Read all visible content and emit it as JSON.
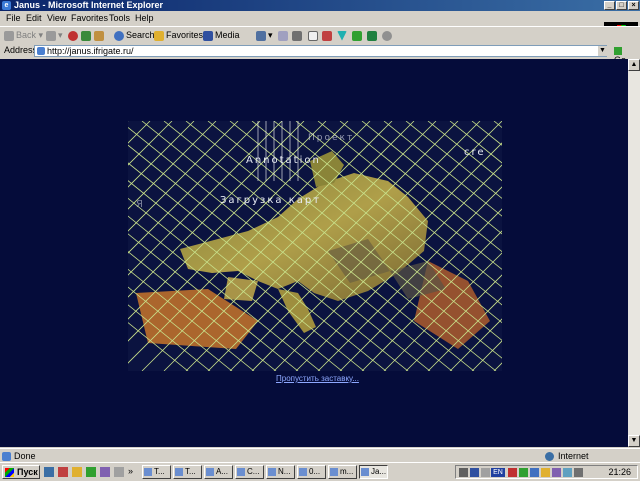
{
  "window": {
    "title": "Janus - Microsoft Internet Explorer"
  },
  "menu": [
    "File",
    "Edit",
    "View",
    "Favorites",
    "Tools",
    "Help"
  ],
  "toolbar": {
    "back": "Back",
    "search": "Search",
    "favorites": "Favorites",
    "media": "Media"
  },
  "address": {
    "label": "Address",
    "url": "http://janus.ifrigate.ru/",
    "go": "Go"
  },
  "page": {
    "overlay_texts": [
      "Annotation",
      "cre",
      "Загрузка карт",
      "Проект",
      "Я"
    ],
    "skip_link": "Пропустить заставку..."
  },
  "status": {
    "left": "Done",
    "zone": "Internet"
  },
  "taskbar": {
    "start": "Пуск",
    "tasks": [
      "T...",
      "T...",
      "A...",
      "C...",
      "N...",
      "0...",
      "m...",
      "Ja..."
    ],
    "lang": "EN",
    "clock": "21:26"
  },
  "colors": {
    "page_bg": "#050c3a",
    "grid": "#c8e08a",
    "link": "#8ea8ff",
    "titlebar": "#0a246a"
  }
}
